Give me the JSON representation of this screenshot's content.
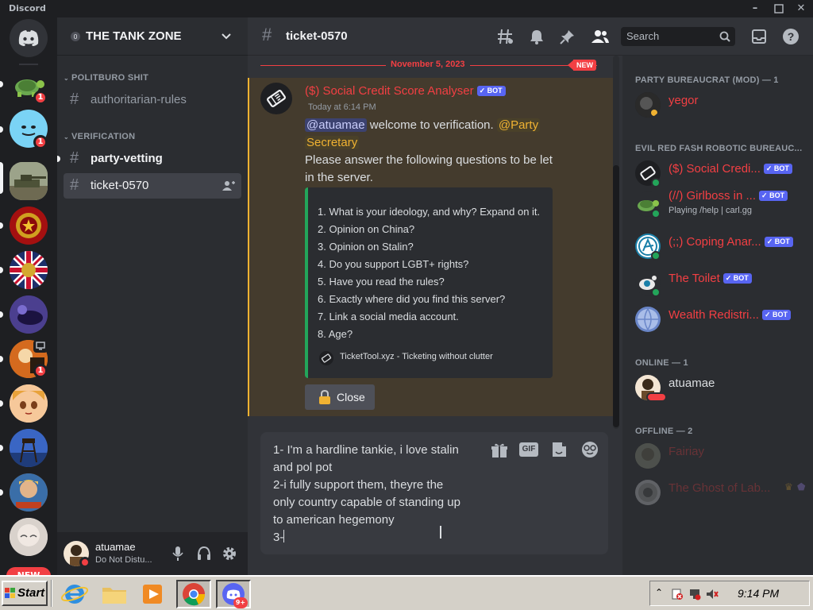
{
  "window": {
    "title": "Discord"
  },
  "rail": {
    "badges": [
      "1",
      "1",
      "1"
    ],
    "new_label": "NEW"
  },
  "guild": {
    "name": "THE TANK ZONE",
    "categories": [
      "POLITBURO SHIT",
      "VERIFICATION"
    ],
    "channels": [
      {
        "name": "authoritarian-rules"
      },
      {
        "name": "party-vetting"
      },
      {
        "name": "ticket-0570"
      }
    ]
  },
  "user_panel": {
    "username": "atuamae",
    "status": "Do Not Distu..."
  },
  "chat_header": {
    "channel": "ticket-0570",
    "search_placeholder": "Search"
  },
  "date_divider": {
    "date": "November 5, 2023",
    "new_tag": "NEW"
  },
  "message": {
    "author": "($) Social Credit Score Analyser",
    "bot_tag": "✓ BOT",
    "timestamp": "Today at 6:14 PM",
    "mention_user": "@atuamae",
    "text_1": " welcome to verification. ",
    "mention_role_1": "@Party",
    "mention_role_2": "Secretary",
    "text_2": "Please answer the following questions to be let",
    "text_3": "in the server.",
    "embed_lines": [
      "1. What is your ideology, and why? Expand on it.",
      "2. Opinion on China?",
      "3. Opinion on Stalin?",
      "4. Do you support LGBT+ rights?",
      "5. Have you read the rules?",
      "6. Exactly where did you find this server?",
      "7. Link a social media account.",
      "8. Age?"
    ],
    "embed_footer": "TicketTool.xyz - Ticketing without clutter",
    "close_button": "Close",
    "accent_color": "#f0b232"
  },
  "composer": {
    "lines": [
      "1- I'm a hardline tankie, i love stalin",
      "and pol pot",
      "2-i fully support them, theyre the",
      "only country capable of standing up",
      "to american hegemony",
      "3-"
    ],
    "gif_label": "GIF"
  },
  "members": {
    "categories": [
      "PARTY BUREAUCRAT (MOD) — 1",
      "EVIL RED FASH ROBOTIC BUREAUC...",
      "ONLINE — 1",
      "OFFLINE — 2"
    ],
    "list": [
      {
        "name": "yegor",
        "activity": "",
        "bot": ""
      },
      {
        "name": "($) Social Credi...",
        "activity": "",
        "bot": "✓ BOT"
      },
      {
        "name": "(//) Girlboss in ...",
        "activity": "Playing /help | carl.gg",
        "bot": "✓ BOT"
      },
      {
        "name": "(;;) Coping Anar...",
        "activity": "",
        "bot": "✓ BOT"
      },
      {
        "name": "The Toilet",
        "activity": "",
        "bot": "✓ BOT"
      },
      {
        "name": "Wealth Redistri...",
        "activity": "",
        "bot": "✓ BOT"
      },
      {
        "name": "atuamae",
        "activity": "",
        "bot": ""
      },
      {
        "name": "Fairiay",
        "activity": "",
        "bot": ""
      },
      {
        "name": "The Ghost of Lab...",
        "activity": "",
        "bot": ""
      }
    ]
  },
  "taskbar": {
    "start_label": "Start",
    "clock": "9:14 PM",
    "discord_badge": "9+"
  },
  "colors": {
    "red_role": "#f23f43",
    "bot_badge": "#5865f2",
    "mention_bg": "#3c4270",
    "role_mention": "#f0b232",
    "taskbar": "#d4d0c8"
  }
}
